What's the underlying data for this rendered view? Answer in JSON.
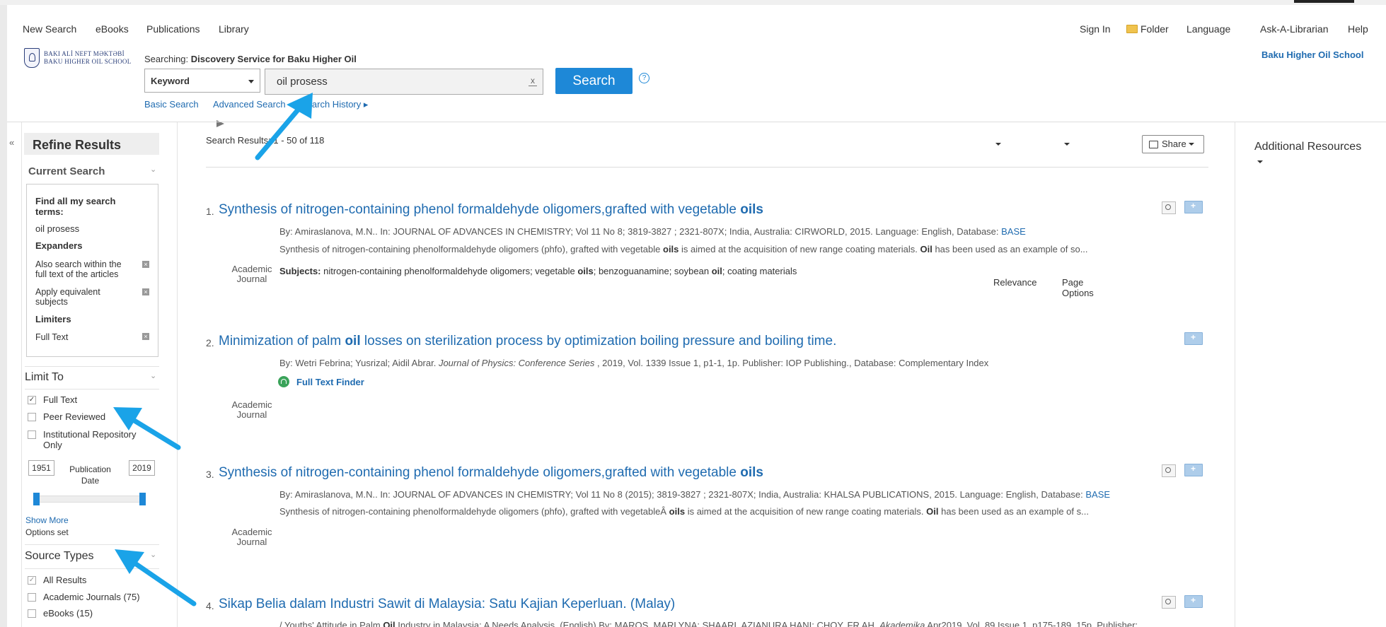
{
  "topnav": {
    "new_search": "New Search",
    "ebooks": "eBooks",
    "publications": "Publications",
    "library": "Library",
    "sign_in": "Sign In",
    "folder": "Folder",
    "language": "Language",
    "ask": "Ask-A-Librarian",
    "help": "Help"
  },
  "header": {
    "logo_line1": "BAKI ALİ NEFT MƏKTƏBİ",
    "logo_line2": "BAKU HIGHER OIL SCHOOL",
    "searching_label": "Searching:",
    "searching_target": "Discovery Service for Baku Higher Oil",
    "field_select": "Keyword",
    "query": "oil prosess",
    "clear": "x",
    "search_button": "Search",
    "help": "?",
    "basic_search": "Basic Search",
    "advanced_search": "Advanced Search",
    "search_history": "Search History ▸",
    "institution": "Baku Higher Oil School"
  },
  "sidebar": {
    "collapse": "«",
    "refine": "Refine Results",
    "current_search": "Current Search",
    "find_all": "Find all my search terms:",
    "query_link": "oil prosess",
    "expanders": "Expanders",
    "expander1": "Also search within the full text of the articles",
    "expander2": "Apply equivalent subjects",
    "limiters": "Limiters",
    "limiter1": "Full Text",
    "limit_to": "Limit To",
    "opt_full_text": "Full Text",
    "opt_peer": "Peer Reviewed",
    "opt_inst": "Institutional Repository Only",
    "year_from": "1951",
    "year_to": "2019",
    "pub_date": "Publication Date",
    "show_more": "Show More",
    "options_set": "Options set",
    "source_types": "Source Types",
    "src_all": "All Results",
    "src_journals": "Academic Journals (75)",
    "src_ebooks": "eBooks (15)"
  },
  "main": {
    "results_count": "Search Results: 1 - 50 of 118",
    "relevance": "Relevance",
    "page_options": "Page Options",
    "share": "Share",
    "additional_resources": "Additional Resources"
  },
  "results": [
    {
      "num": "1.",
      "title_pre": "Synthesis of nitrogen-containing phenol formaldehyde oligomers,grafted with vegetable ",
      "title_bold": "oils",
      "meta": "By: Amiraslanova, M.N.. In: JOURNAL OF ADVANCES IN CHEMISTRY; Vol 11 No 8; 3819-3827 ; 2321-807X; India, Australia: CIRWORLD, 2015. Language: English, Database: ",
      "meta_link": "BASE",
      "abstract_a": "Synthesis of nitrogen-containing phenolformaldehyde oligomers (phfo), grafted with vegetable ",
      "abstract_b": "oils",
      "abstract_c": " is aimed at the acquisition of new range coating materials. ",
      "abstract_d": "Oil",
      "abstract_e": " has been used as an example of so...",
      "subjects_label": "Subjects:",
      "subj_a": " nitrogen-containing phenolformaldehyde oligomers; vegetable ",
      "subj_b": "oils",
      "subj_c": "; benzoguanamine; soybean ",
      "subj_d": "oil",
      "subj_e": "; coating materials",
      "ptype": "Academic Journal"
    },
    {
      "num": "2.",
      "title_pre": "Minimization of palm ",
      "title_bold": "oil",
      "title_post": " losses on sterilization process by optimization boiling pressure and boiling time.",
      "meta_a": "By: Wetri Febrina; Yusrizal; Aidil Abrar. ",
      "meta_i": "Journal of Physics: Conference Series",
      "meta_b": " , 2019, Vol. 1339 Issue 1, p1-1, 1p. Publisher: IOP Publishing., Database: Complementary Index",
      "full_text_finder": "Full Text Finder",
      "ptype": "Academic Journal"
    },
    {
      "num": "3.",
      "title_pre": "Synthesis of nitrogen-containing phenol formaldehyde oligomers,grafted with vegetable ",
      "title_bold": "oils",
      "meta": "By: Amiraslanova, M.N.. In: JOURNAL OF ADVANCES IN CHEMISTRY; Vol 11 No 8 (2015); 3819-3827 ; 2321-807X; India, Australia: KHALSA PUBLICATIONS, 2015. Language: English, Database: ",
      "meta_link": "BASE",
      "abstract_a": "Synthesis of nitrogen-containing phenolformaldehyde oligomers (phfo), grafted with vegetableÂ ",
      "abstract_b": "oils",
      "abstract_c": " is aimed at the acquisition of new range coating materials. ",
      "abstract_d": "Oil",
      "abstract_e": " has been used as an example of s...",
      "ptype": "Academic Journal"
    },
    {
      "num": "4.",
      "title": "Sikap Belia dalam Industri Sawit di Malaysia: Satu Kajian Keperluan. (Malay)",
      "meta_a": "/ Youths' Attitude in Palm ",
      "meta_b": "Oil",
      "meta_c": " Industry in Malaysia: A Needs Analysis. (English) By: MAROS, MARLYNA; SHAARI, AZIANURA HANI; CHOY, FR AH. ",
      "meta_i": "Akademika",
      "meta_d": " Apr2019, Vol. 89 Issue 1, p175-189. 15p. Publisher:"
    }
  ],
  "colors": {
    "link": "#1f6bb0",
    "search_button": "#1e88d7",
    "arrow": "#1aa3e8"
  }
}
